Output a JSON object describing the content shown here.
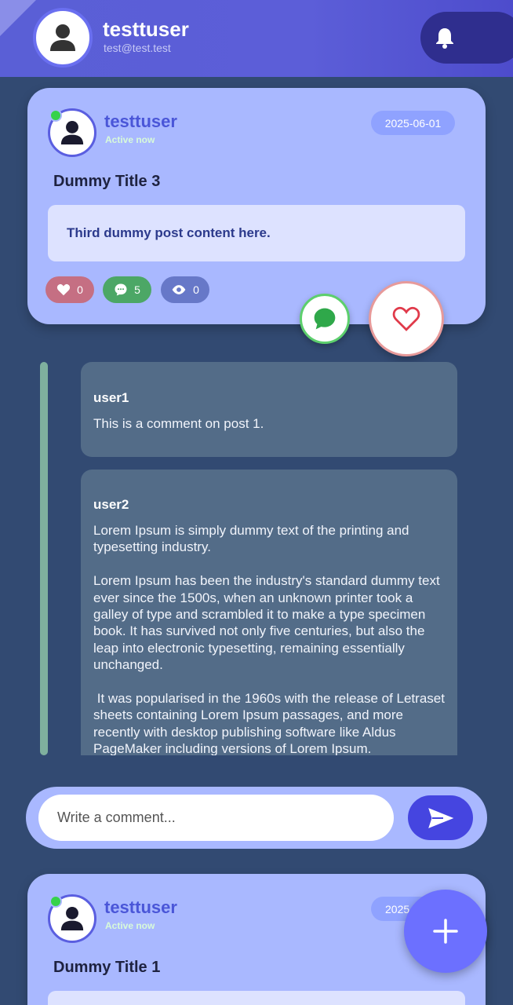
{
  "header": {
    "username": "testtuser",
    "email": "test@test.test",
    "avatar_icon": "user-icon",
    "notification_icon": "bell-icon"
  },
  "posts": [
    {
      "username": "testtuser",
      "status": "Active now",
      "date": "2025-06-01",
      "title": "Dummy Title 3",
      "content": "Third dummy post content here.",
      "likes": "0",
      "comments": "5",
      "views": "0"
    },
    {
      "username": "testtuser",
      "status": "Active now",
      "date": "2025",
      "title": "Dummy Title 1"
    }
  ],
  "comments": [
    {
      "author": "user1",
      "text": "This is a comment on post 1."
    },
    {
      "author": "user2",
      "text": "Lorem Ipsum is simply dummy text of the printing and typesetting industry.\n\nLorem Ipsum has been the industry's standard dummy text ever since the 1500s, when an unknown printer took a galley of type and scrambled it to make a type specimen book. It has survived not only five centuries, but also the leap into electronic typesetting, remaining essentially unchanged.\n\n It was popularised in the 1960s with the release of Letraset sheets containing Lorem Ipsum passages, and more recently with desktop publishing software like Aldus PageMaker including versions of Lorem Ipsum."
    }
  ],
  "comment_input": {
    "placeholder": "Write a comment..."
  },
  "colors": {
    "background": "#324a72",
    "header": "#5a5fd6",
    "card": "#a9b8ff",
    "accent": "#4545e0",
    "online": "#36d24a"
  }
}
